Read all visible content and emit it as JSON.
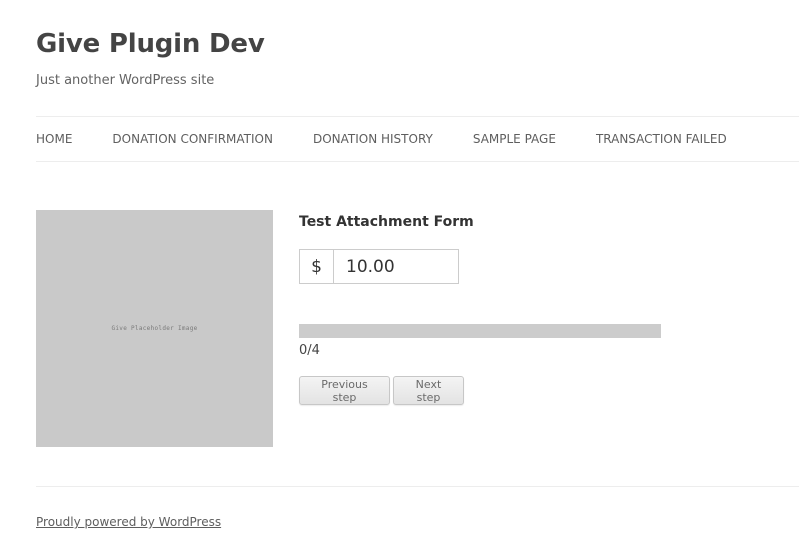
{
  "site": {
    "title": "Give Plugin Dev",
    "description": "Just another WordPress site"
  },
  "nav": {
    "items": [
      {
        "label": "HOME"
      },
      {
        "label": "DONATION CONFIRMATION"
      },
      {
        "label": "DONATION HISTORY"
      },
      {
        "label": "SAMPLE PAGE"
      },
      {
        "label": "TRANSACTION FAILED"
      }
    ]
  },
  "form": {
    "image_label": "Give Placeholder Image",
    "title": "Test Attachment Form",
    "currency_symbol": "$",
    "amount_value": "10.00",
    "progress": {
      "text": "0/4",
      "fraction": 0
    },
    "prev_label": "Previous step",
    "next_label": "Next step"
  },
  "footer": {
    "link_label": "Proudly powered by WordPress"
  },
  "colors": {
    "placeholder_bg": "#c9c9c9",
    "progress_track": "#cccccc",
    "text": "#444444"
  }
}
